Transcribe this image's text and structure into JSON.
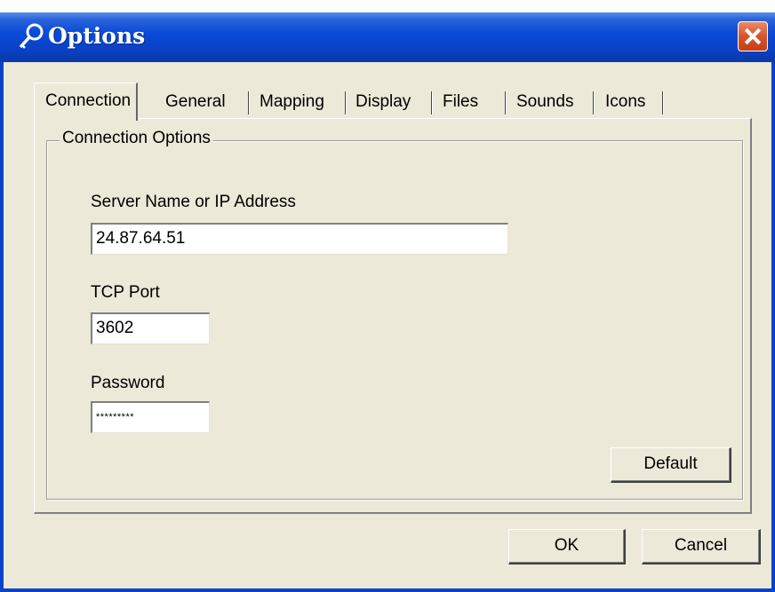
{
  "window": {
    "title": "Options",
    "accent": "#0843c8",
    "close_color": "#d8532a"
  },
  "tabs": [
    {
      "label": "Connection"
    },
    {
      "label": "General"
    },
    {
      "label": "Mapping"
    },
    {
      "label": "Display"
    },
    {
      "label": "Files"
    },
    {
      "label": "Sounds"
    },
    {
      "label": "Icons"
    }
  ],
  "group": {
    "legend": "Connection Options"
  },
  "fields": {
    "server": {
      "label": "Server Name or IP Address",
      "value": "24.87.64.51"
    },
    "port": {
      "label": "TCP Port",
      "value": "3602"
    },
    "password": {
      "label": "Password",
      "value": "*********"
    }
  },
  "buttons": {
    "default": "Default",
    "ok": "OK",
    "cancel": "Cancel"
  },
  "icons": {
    "title": "key-icon",
    "close": "close-icon"
  }
}
